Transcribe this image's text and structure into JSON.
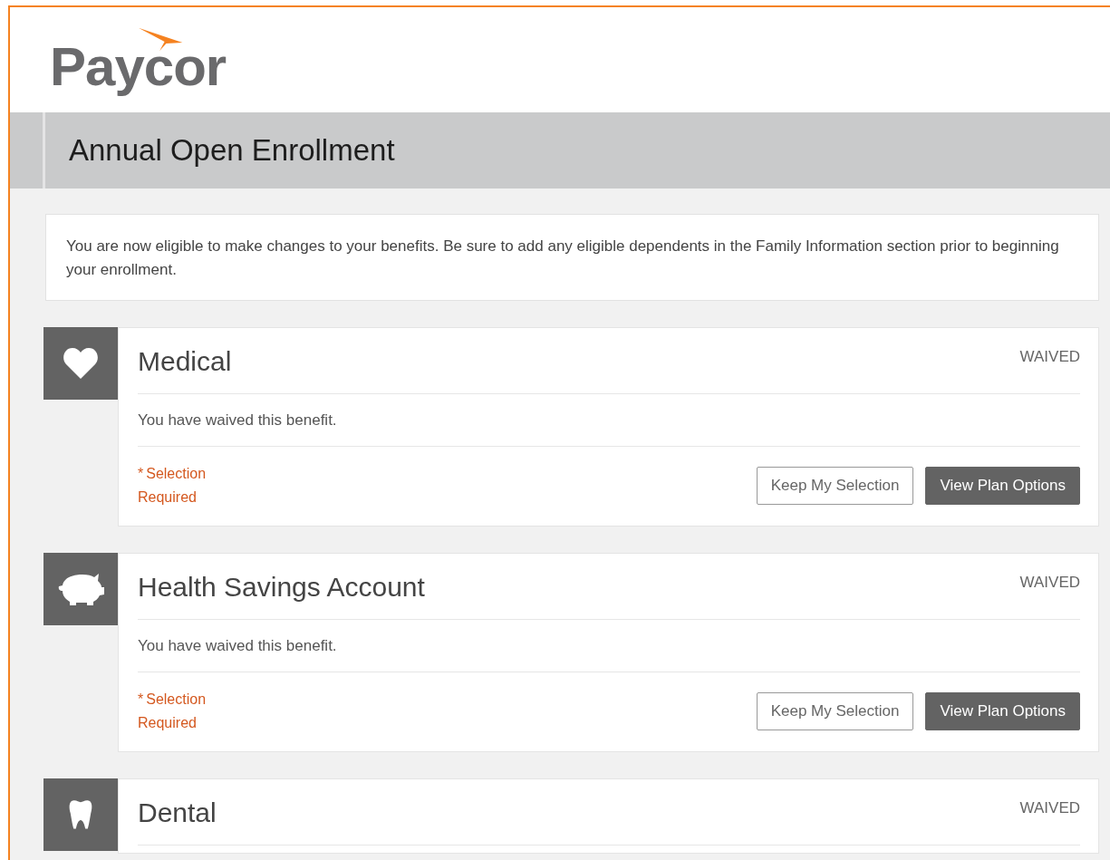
{
  "logo": {
    "text": "Paycor"
  },
  "page_title": "Annual Open Enrollment",
  "notice": "You are now eligible to make changes to your benefits. Be sure to add any eligible dependents in the Family Information section prior to beginning your enrollment.",
  "benefits": [
    {
      "kind": "heart",
      "title": "Medical",
      "status": "WAIVED",
      "description": "You have waived this benefit.",
      "required_mark": "*",
      "required": "Selection Required",
      "buttons": [
        {
          "label": "Keep My Selection",
          "kind": "secondary"
        },
        {
          "label": "View Plan Options",
          "kind": "primary"
        }
      ]
    },
    {
      "kind": "piggy",
      "title": "Health Savings Account",
      "status": "WAIVED",
      "description": "You have waived this benefit.",
      "required_mark": "*",
      "required": "Selection Required",
      "buttons": [
        {
          "label": "Keep My Selection",
          "kind": "secondary"
        },
        {
          "label": "View Plan Options",
          "kind": "primary"
        }
      ]
    },
    {
      "kind": "tooth",
      "title": "Dental",
      "status": "WAIVED"
    }
  ]
}
